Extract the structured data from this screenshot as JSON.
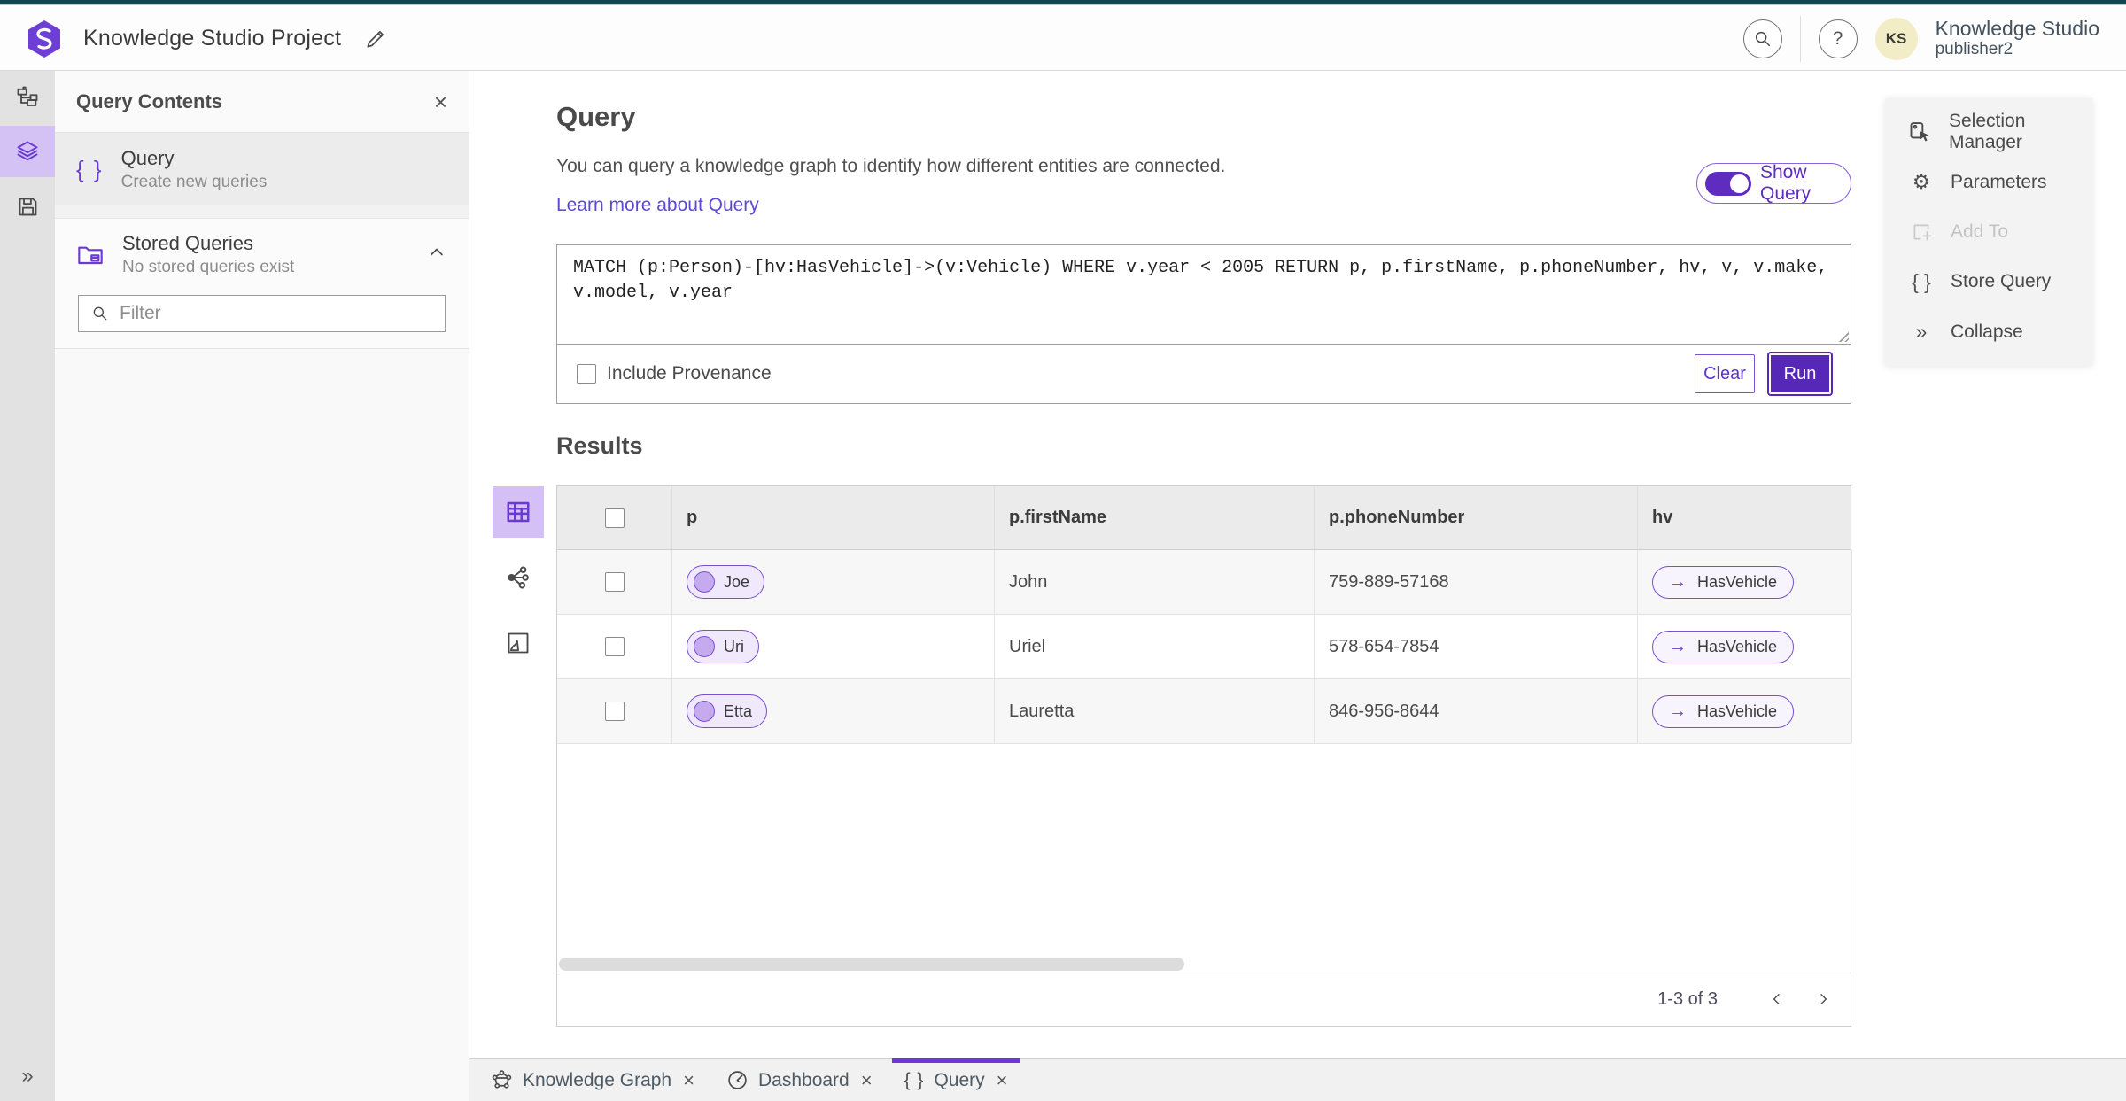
{
  "topbar": {
    "project_title": "Knowledge Studio Project",
    "app_name": "Knowledge Studio",
    "user_name": "publisher2",
    "avatar_initials": "KS"
  },
  "left_panel": {
    "title": "Query Contents",
    "query_item_title": "Query",
    "query_item_subtitle": "Create new queries",
    "stored_title": "Stored Queries",
    "stored_subtitle": "No stored queries exist",
    "filter_placeholder": "Filter"
  },
  "query_section": {
    "heading": "Query",
    "description": "You can query a knowledge graph to identify how different entities are connected.",
    "learn_more_label": "Learn more about Query",
    "show_query_label": "Show Query",
    "query_text": "MATCH (p:Person)-[hv:HasVehicle]->(v:Vehicle) WHERE v.year < 2005 RETURN p, p.firstName, p.phoneNumber, hv, v, v.make, v.model, v.year",
    "include_provenance_label": "Include Provenance",
    "clear_label": "Clear",
    "run_label": "Run"
  },
  "results": {
    "heading": "Results",
    "columns": [
      "p",
      "p.firstName",
      "p.phoneNumber",
      "hv"
    ],
    "rows": [
      {
        "p": "Joe",
        "firstName": "John",
        "phone": "759-889-57168",
        "hv": "HasVehicle"
      },
      {
        "p": "Uri",
        "firstName": "Uriel",
        "phone": "578-654-7854",
        "hv": "HasVehicle"
      },
      {
        "p": "Etta",
        "firstName": "Lauretta",
        "phone": "846-956-8644",
        "hv": "HasVehicle"
      }
    ],
    "pagination": "1-3 of 3"
  },
  "right_panel": {
    "items": [
      {
        "label": "Selection Manager"
      },
      {
        "label": "Parameters"
      },
      {
        "label": "Add To"
      },
      {
        "label": "Store Query"
      },
      {
        "label": "Collapse"
      }
    ]
  },
  "tabs": [
    {
      "label": "Knowledge Graph"
    },
    {
      "label": "Dashboard"
    },
    {
      "label": "Query"
    }
  ],
  "icons": {
    "close": "×",
    "braces": "{ }",
    "help": "?",
    "gear": "⚙",
    "collapse": "»",
    "arrow_right": "→"
  },
  "colors": {
    "accent": "#5e2cbe",
    "top_strip": "#16454d",
    "active_tab_bar": "#6d35dc",
    "avatar_bg": "#f2edc6",
    "link": "#5b49d4"
  }
}
